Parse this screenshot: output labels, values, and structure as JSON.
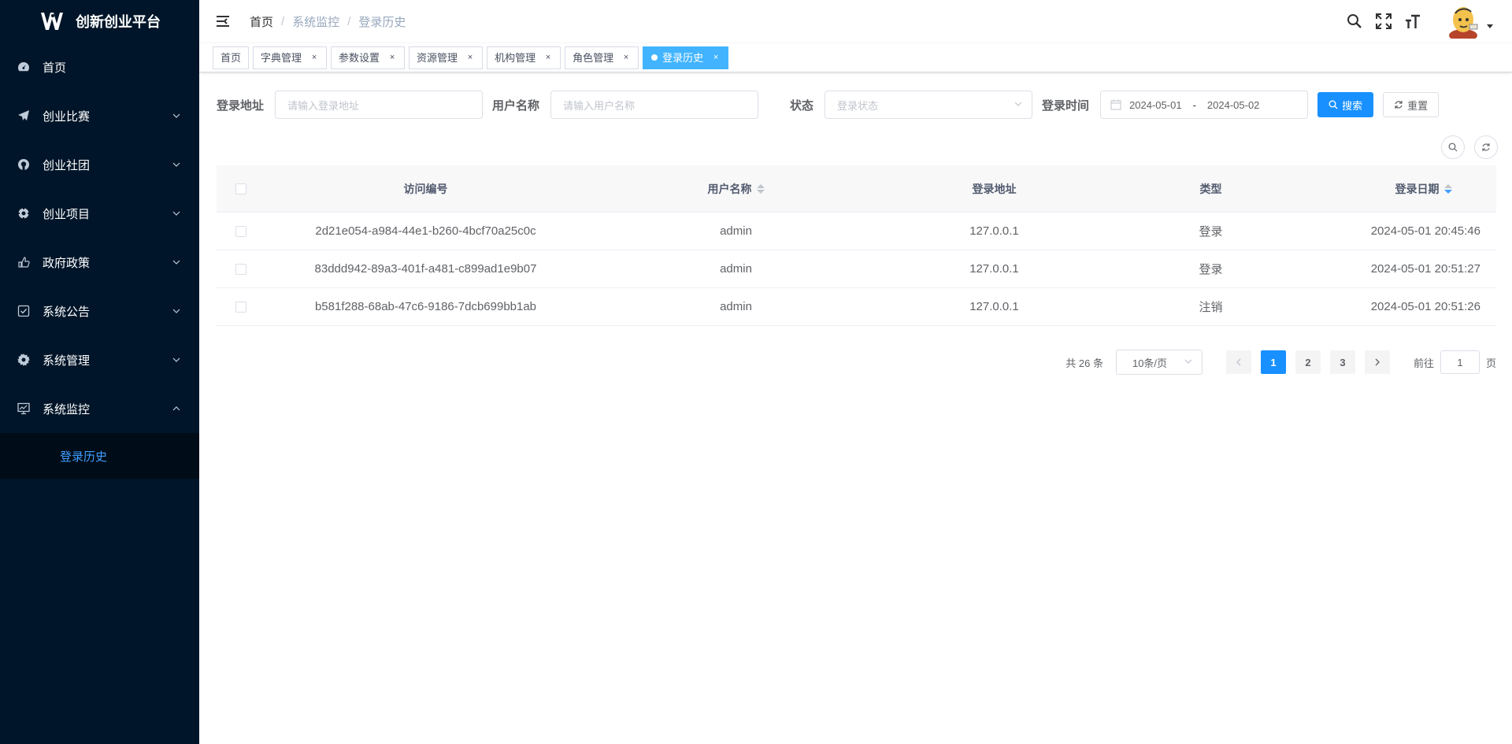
{
  "app": {
    "title": "创新创业平台"
  },
  "sidebar": {
    "items": [
      {
        "label": "首页",
        "icon": "dashboard-icon",
        "expandable": false
      },
      {
        "label": "创业比赛",
        "icon": "paper-plane-icon",
        "expandable": true
      },
      {
        "label": "创业社团",
        "icon": "github-icon",
        "expandable": true
      },
      {
        "label": "创业项目",
        "icon": "compass-icon",
        "expandable": true
      },
      {
        "label": "政府政策",
        "icon": "hand-icon",
        "expandable": true
      },
      {
        "label": "系统公告",
        "icon": "checkbox-icon",
        "expandable": true
      },
      {
        "label": "系统管理",
        "icon": "gear-icon",
        "expandable": true
      },
      {
        "label": "系统监控",
        "icon": "monitor-icon",
        "expandable": true,
        "expanded": true
      }
    ],
    "submenu": {
      "label": "登录历史"
    }
  },
  "header": {
    "breadcrumb": [
      "首页",
      "系统监控",
      "登录历史"
    ]
  },
  "tags": [
    {
      "label": "首页",
      "closable": false
    },
    {
      "label": "字典管理",
      "closable": true
    },
    {
      "label": "参数设置",
      "closable": true
    },
    {
      "label": "资源管理",
      "closable": true
    },
    {
      "label": "机构管理",
      "closable": true
    },
    {
      "label": "角色管理",
      "closable": true
    },
    {
      "label": "登录历史",
      "closable": true,
      "active": true
    }
  ],
  "search": {
    "address_label": "登录地址",
    "address_placeholder": "请输入登录地址",
    "username_label": "用户名称",
    "username_placeholder": "请输入用户名称",
    "status_label": "状态",
    "status_placeholder": "登录状态",
    "time_label": "登录时间",
    "date_start": "2024-05-01",
    "date_sep": "-",
    "date_end": "2024-05-02",
    "search_button": "搜索",
    "reset_button": "重置"
  },
  "table": {
    "columns": {
      "id": "访问编号",
      "username": "用户名称",
      "address": "登录地址",
      "type": "类型",
      "date": "登录日期"
    },
    "rows": [
      {
        "id": "2d21e054-a984-44e1-b260-4bcf70a25c0c",
        "username": "admin",
        "address": "127.0.0.1",
        "type": "登录",
        "date": "2024-05-01 20:45:46"
      },
      {
        "id": "83ddd942-89a3-401f-a481-c899ad1e9b07",
        "username": "admin",
        "address": "127.0.0.1",
        "type": "登录",
        "date": "2024-05-01 20:51:27"
      },
      {
        "id": "b581f288-68ab-47c6-9186-7dcb699bb1ab",
        "username": "admin",
        "address": "127.0.0.1",
        "type": "注销",
        "date": "2024-05-01 20:51:26"
      }
    ]
  },
  "pagination": {
    "total": "共 26 条",
    "page_size": "10条/页",
    "pages": [
      "1",
      "2",
      "3"
    ],
    "current": "1",
    "goto_label": "前往",
    "goto_value": "1",
    "page_suffix": "页"
  },
  "colors": {
    "sidebar_bg": "#001529",
    "accent": "#1890ff",
    "active_tag": "#42b4ff"
  }
}
